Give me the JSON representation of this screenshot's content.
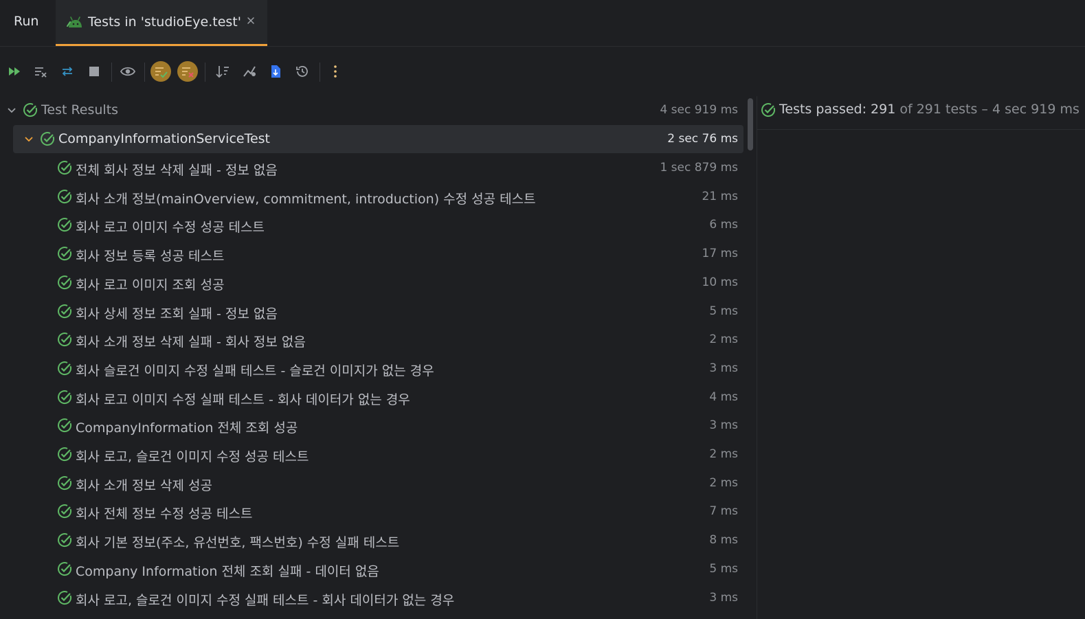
{
  "tabs": {
    "run_label": "Run",
    "tests_label": "Tests in 'studioEye.test'"
  },
  "toolbar": {
    "buttons": [
      "rerun-icon",
      "rerun-failed-icon",
      "toggle-auto-test-icon",
      "stop-icon",
      "show-ignored-icon",
      "show-passed-icon",
      "show-failed-icon",
      "sort-icon",
      "import-tests-icon",
      "export-icon",
      "history-icon",
      "more-icon"
    ]
  },
  "colors": {
    "accent": "#f0a13a",
    "pass": "#5fb865",
    "active_button": "#a27a2a"
  },
  "tree": {
    "root": {
      "name": "Test Results",
      "duration": "4 sec 919 ms"
    },
    "suite": {
      "name": "CompanyInformationServiceTest",
      "duration": "2 sec 76 ms"
    },
    "tests": [
      {
        "name": "전체 회사 정보 삭제 실패 - 정보 없음",
        "duration": "1 sec 879 ms"
      },
      {
        "name": "회사 소개 정보(mainOverview, commitment, introduction) 수정 성공 테스트",
        "duration": "21 ms"
      },
      {
        "name": "회사 로고 이미지 수정 성공 테스트",
        "duration": "6 ms"
      },
      {
        "name": "회사 정보 등록 성공 테스트",
        "duration": "17 ms"
      },
      {
        "name": "회사 로고 이미지 조회 성공",
        "duration": "10 ms"
      },
      {
        "name": "회사 상세 정보 조회 실패 - 정보 없음",
        "duration": "5 ms"
      },
      {
        "name": "회사 소개 정보 삭제 실패 - 회사 정보 없음",
        "duration": "2 ms"
      },
      {
        "name": "회사 슬로건 이미지 수정 실패 테스트 - 슬로건 이미지가 없는 경우",
        "duration": "3 ms"
      },
      {
        "name": "회사 로고 이미지 수정 실패 테스트 - 회사 데이터가 없는 경우",
        "duration": "4 ms"
      },
      {
        "name": "CompanyInformation 전체 조회 성공",
        "duration": "3 ms"
      },
      {
        "name": "회사 로고, 슬로건 이미지 수정 성공 테스트",
        "duration": "2 ms"
      },
      {
        "name": "회사 소개 정보 삭제 성공",
        "duration": "2 ms"
      },
      {
        "name": "회사 전체 정보 수정 성공 테스트",
        "duration": "7 ms"
      },
      {
        "name": "회사 기본 정보(주소, 유선번호, 팩스번호) 수정 실패 테스트",
        "duration": "8 ms"
      },
      {
        "name": "Company Information 전체 조회 실패 - 데이터 없음",
        "duration": "5 ms"
      },
      {
        "name": "회사 로고, 슬로건 이미지 수정 실패 테스트 - 회사 데이터가 없는 경우",
        "duration": "3 ms"
      }
    ]
  },
  "summary": {
    "label": "Tests passed: 291",
    "rest": " of 291 tests – 4 sec 919 ms"
  }
}
